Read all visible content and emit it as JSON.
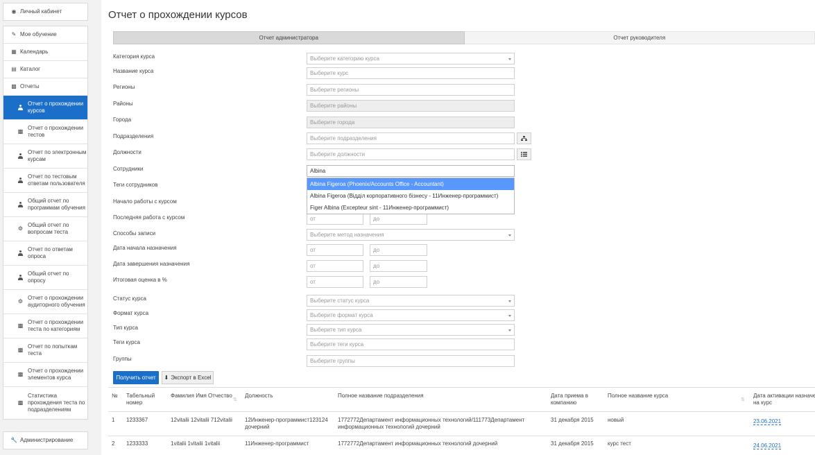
{
  "sidebar": {
    "cabinet": "Личный кабинет",
    "my_learning": "Мое обучение",
    "calendar": "Календарь",
    "catalog": "Каталог",
    "reports": "Отчеты",
    "report_items": [
      {
        "line1": "Отчет о прохождении",
        "line2": "курсов",
        "icon": "person-icon"
      },
      {
        "line1": "Отчет о прохождении",
        "line2": "тестов",
        "icon": "bar-chart-icon"
      },
      {
        "line1": "Отчет по электронным",
        "line2": "курсам",
        "icon": "person-icon"
      },
      {
        "line1": "Отчет по тестовым",
        "line2": "ответам пользователя",
        "icon": "person-icon"
      },
      {
        "line1": "Общий отчет по",
        "line2": "программам обучения",
        "icon": "person-icon"
      },
      {
        "line1": "Общий отчет по",
        "line2": "вопросам теста",
        "icon": "gears-icon"
      },
      {
        "line1": "Отчет по ответам",
        "line2": "опроса",
        "icon": "person-icon"
      },
      {
        "line1": "Общий отчет по",
        "line2": "опросу",
        "icon": "person-icon"
      },
      {
        "line1": "Отчет о прохождении",
        "line2": "аудиторного обучения",
        "icon": "gears-icon"
      },
      {
        "line1": "Отчет о прохождении",
        "line2": "теста по категориям",
        "icon": "bar-chart-icon"
      },
      {
        "line1": "Отчет по попыткам",
        "line2": "теста",
        "icon": "bar-chart-icon"
      },
      {
        "line1": "Отчет о прохождении",
        "line2": "элементов курса",
        "icon": "bar-chart-icon"
      }
    ],
    "last_item": {
      "line1": "Статистика",
      "line2": "прохождения теста по",
      "line3": "подразделениям"
    },
    "admin": "Администрирование"
  },
  "page_title": "Отчет о прохождении курсов",
  "tabs": {
    "admin": "Отчет администратора",
    "manager": "Отчет руководителя"
  },
  "form": {
    "course_category": {
      "label": "Категория курса",
      "placeholder": "Выберите категорию курса"
    },
    "course_name": {
      "label": "Название курса",
      "placeholder": "Выберите курс"
    },
    "regions": {
      "label": "Регионы",
      "placeholder": "Выберите регионы"
    },
    "districts": {
      "label": "Районы",
      "placeholder": "Выберите районы"
    },
    "cities": {
      "label": "Города",
      "placeholder": "Выберите города"
    },
    "departments": {
      "label": "Подразделения",
      "placeholder": "Выберите подразделения"
    },
    "positions": {
      "label": "Должности",
      "placeholder": "Выберите должности"
    },
    "employees": {
      "label": "Сотрудники",
      "value": "Albina"
    },
    "employee_tags": {
      "label": "Теги сотрудников"
    },
    "course_start": {
      "label": "Начало работы с курсом"
    },
    "course_last": {
      "label": "Последняя работа с курсом",
      "from": "от",
      "to": "до"
    },
    "enroll_methods": {
      "label": "Способы записи",
      "placeholder": "Выберите метод назначения"
    },
    "assign_start": {
      "label": "Дата начала назначения",
      "from": "от",
      "to": "до"
    },
    "assign_end": {
      "label": "Дата завершения назначения",
      "from": "от",
      "to": "до"
    },
    "final_grade": {
      "label": "Итоговая оценка в %",
      "from": "от",
      "to": "до"
    },
    "course_status": {
      "label": "Статус курса",
      "placeholder": "Выберите статус курса"
    },
    "course_format": {
      "label": "Формат курса",
      "placeholder": "Выберите формат курса"
    },
    "course_type": {
      "label": "Тип курса",
      "placeholder": "Выберите тип курса"
    },
    "course_tags": {
      "label": "Теги курса",
      "placeholder": "Выберите теги курса"
    },
    "groups": {
      "label": "Группы",
      "placeholder": "Выберите группы"
    }
  },
  "dropdown": [
    "Albina Figeroa (Phoenix/Accounts Office - Accountant)",
    "Albina Figeroa (Відділ корпоративного бізнесу - 11Инженер-программист)",
    "Figer Albina (Excepteur sint - 11Инженер-программист)"
  ],
  "buttons": {
    "get_report": "Получить отчет",
    "export": "Экспорт в Excel"
  },
  "table": {
    "headers": {
      "num": "№",
      "tab_num_1": "Табельный",
      "tab_num_2": "номер",
      "fio": "Фамилия Имя Отчество",
      "position": "Должность",
      "dept": "Полное название подразделения",
      "hire_1": "Дата приема в",
      "hire_2": "компанию",
      "course": "Полное название курса",
      "activation_1": "Дата активации назначения",
      "activation_2": "на курс"
    },
    "rows": [
      {
        "num": "1",
        "tab": "1233367",
        "fio": "12vitalii 12vitalii 712vitalii",
        "pos1": "12Инженер-программист123124",
        "pos2": "дочерний",
        "dept1": "1772772Департамент информационных технологий/111773Департамент",
        "dept2": "информационных технологий дочерний",
        "hire": "31 декабря 2015",
        "course": "новый",
        "activation": "23.06.2021"
      },
      {
        "num": "2",
        "tab": "1233333",
        "fio": "1vitalii 1vitalii 1vitalii",
        "pos1": "11Инженер-программист",
        "pos2": "",
        "dept1": "1772772Департамент информационных технологий дочерний",
        "dept2": "",
        "hire": "31 декабря 2015",
        "course": "курс тест",
        "activation": "24.06.2021"
      }
    ]
  }
}
